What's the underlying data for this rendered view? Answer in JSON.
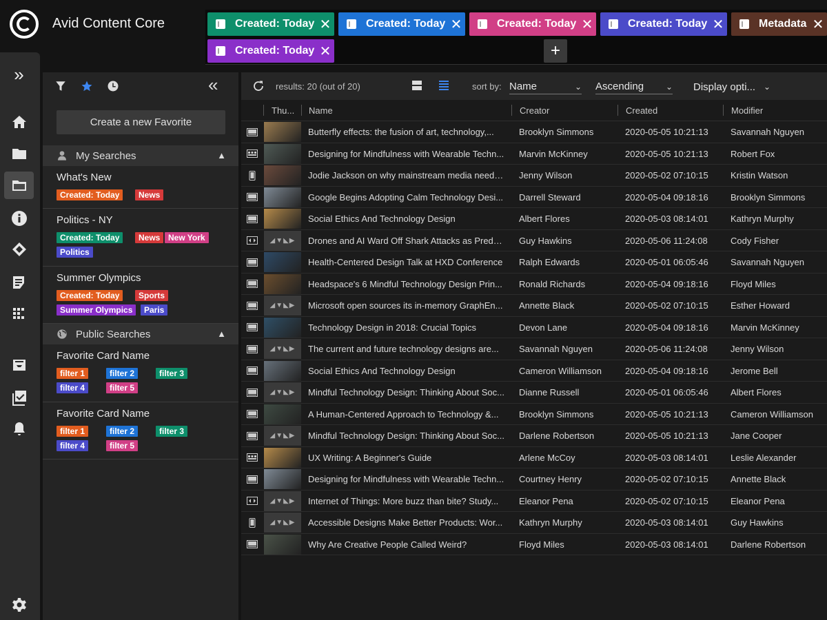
{
  "app": {
    "title": "Avid Content Core"
  },
  "tabs": [
    {
      "label": "Created: Today",
      "color": "#0e8f6b"
    },
    {
      "label": "Created: Today",
      "color": "#1e73d6"
    },
    {
      "label": "Created: Today",
      "color": "#d13f86"
    },
    {
      "label": "Created: Today",
      "color": "#4b4bc9"
    },
    {
      "label": "Metadata",
      "color": "#5a3326"
    },
    {
      "label": "Created: Today",
      "color": "#8a2fc9"
    }
  ],
  "tab_close_glyph": "✕",
  "tab_add_glyph": "+",
  "rail": {
    "expand_glyph": "»",
    "icons": [
      "home-icon",
      "folder-icon",
      "folder-open-icon",
      "info-icon",
      "link-icon",
      "checklist-icon",
      "grid-icon",
      "inbox-icon",
      "tasks-icon",
      "bell-icon",
      "settings-icon"
    ]
  },
  "favorites": {
    "create_label": "Create a new Favorite",
    "collapse_glyph": "«",
    "my_searches_label": "My Searches",
    "public_searches_label": "Public Searches",
    "my_searches": [
      {
        "title": "What's New",
        "tags": [
          {
            "label": "Created: Today",
            "color": "#e25d1f"
          },
          {
            "label": "News",
            "color": "#d63a3a"
          }
        ]
      },
      {
        "title": "Politics - NY",
        "tags": [
          {
            "label": "Created: Today",
            "color": "#0e8f6b"
          },
          {
            "label": "News",
            "color": "#d63a3a"
          },
          {
            "label": "New York",
            "color": "#d13f86"
          },
          {
            "label": "Politics",
            "color": "#4b4bc9"
          }
        ]
      },
      {
        "title": "Summer Olympics",
        "tags": [
          {
            "label": "Created: Today",
            "color": "#e25d1f"
          },
          {
            "label": "Sports",
            "color": "#d63a3a"
          },
          {
            "label": "Summer Olympics",
            "color": "#8a2fc9"
          },
          {
            "label": "Paris",
            "color": "#4b4bc9"
          }
        ]
      }
    ],
    "public_searches": [
      {
        "title": "Favorite Card Name",
        "tags": [
          {
            "label": "filter 1",
            "color": "#e25d1f"
          },
          {
            "label": "filter 2",
            "color": "#1e73d6"
          },
          {
            "label": "filter 3",
            "color": "#0e8f6b"
          },
          {
            "label": "filter 4",
            "color": "#4b4bc9"
          },
          {
            "label": "filter 5",
            "color": "#d13f86"
          }
        ]
      },
      {
        "title": "Favorite Card Name",
        "tags": [
          {
            "label": "filter 1",
            "color": "#e25d1f"
          },
          {
            "label": "filter 2",
            "color": "#1e73d6"
          },
          {
            "label": "filter 3",
            "color": "#0e8f6b"
          },
          {
            "label": "filter 4",
            "color": "#4b4bc9"
          },
          {
            "label": "filter 5",
            "color": "#d13f86"
          }
        ]
      }
    ]
  },
  "results": {
    "count_label": "results: 20 (out of 20)",
    "sort_by_label": "sort by:",
    "sort_field": "Name",
    "sort_order": "Ascending",
    "display_options": "Display opti...",
    "columns": [
      "Thu...",
      "Name",
      "Creator",
      "Created",
      "Modifier"
    ],
    "placeholder_thumb": "◢▼◣▶",
    "rows": [
      {
        "type": "video",
        "thumb": "#9a7b4f",
        "name": "Butterfly effects: the fusion of art, technology,...",
        "creator": "Brooklyn Simmons",
        "created": "2020-05-05 10:21:13",
        "modifier": "Savannah Nguyen"
      },
      {
        "type": "sequence",
        "thumb": "#4f5a55",
        "name": "Designing for Mindfulness with Wearable Techn...",
        "creator": "Marvin McKinney",
        "created": "2020-05-05 10:21:13",
        "modifier": "Robert Fox"
      },
      {
        "type": "mobile",
        "thumb": "#6a4a3c",
        "name": "Jodie Jackson on why mainstream media needs...",
        "creator": "Jenny Wilson",
        "created": "2020-05-02 07:10:15",
        "modifier": "Kristin Watson"
      },
      {
        "type": "video",
        "thumb": "#7f8a95",
        "name": "Google Begins Adopting Calm Technology Desi...",
        "creator": "Darrell Steward",
        "created": "2020-05-04 09:18:16",
        "modifier": "Brooklyn Simmons"
      },
      {
        "type": "video",
        "thumb": "#b58a4a",
        "name": "Social Ethics And Technology Design",
        "creator": "Albert Flores",
        "created": "2020-05-03 08:14:01",
        "modifier": "Kathryn Murphy"
      },
      {
        "type": "audio",
        "thumb": "",
        "name": "Drones and AI Ward Off Shark Attacks as Preda...",
        "creator": "Guy Hawkins",
        "created": "2020-05-06 11:24:08",
        "modifier": "Cody Fisher"
      },
      {
        "type": "video",
        "thumb": "#2e4a66",
        "name": "Health-Centered Design Talk at HXD Conference",
        "creator": "Ralph Edwards",
        "created": "2020-05-01 06:05:46",
        "modifier": "Savannah Nguyen"
      },
      {
        "type": "video",
        "thumb": "#6b4e2e",
        "name": "Headspace's 6 Mindful Technology Design Prin...",
        "creator": "Ronald Richards",
        "created": "2020-05-04 09:18:16",
        "modifier": "Floyd Miles"
      },
      {
        "type": "video",
        "thumb": "",
        "name": "Microsoft open sources its in-memory GraphEn...",
        "creator": "Annette Black",
        "created": "2020-05-02 07:10:15",
        "modifier": "Esther Howard"
      },
      {
        "type": "video",
        "thumb": "#2f4f66",
        "name": "Technology Design in 2018: Crucial Topics",
        "creator": "Devon Lane",
        "created": "2020-05-04 09:18:16",
        "modifier": "Marvin McKinney"
      },
      {
        "type": "video",
        "thumb": "",
        "name": "The current and future technology designs are...",
        "creator": "Savannah Nguyen",
        "created": "2020-05-06 11:24:08",
        "modifier": "Jenny Wilson"
      },
      {
        "type": "video",
        "thumb": "#66707a",
        "name": "Social Ethics And Technology Design",
        "creator": "Cameron Williamson",
        "created": "2020-05-04 09:18:16",
        "modifier": "Jerome Bell"
      },
      {
        "type": "video",
        "thumb": "",
        "name": "Mindful Technology Design: Thinking About Soc...",
        "creator": "Dianne Russell",
        "created": "2020-05-01 06:05:46",
        "modifier": "Albert Flores"
      },
      {
        "type": "video",
        "thumb": "#3e4a42",
        "name": "A Human-Centered Approach to Technology &...",
        "creator": "Brooklyn Simmons",
        "created": "2020-05-05 10:21:13",
        "modifier": "Cameron Williamson"
      },
      {
        "type": "video",
        "thumb": "",
        "name": "Mindful Technology Design: Thinking About Soc...",
        "creator": "Darlene Robertson",
        "created": "2020-05-05 10:21:13",
        "modifier": "Jane Cooper"
      },
      {
        "type": "sequence",
        "thumb": "#b58a4a",
        "name": "UX Writing: A Beginner's Guide",
        "creator": "Arlene McCoy",
        "created": "2020-05-03 08:14:01",
        "modifier": "Leslie Alexander"
      },
      {
        "type": "video",
        "thumb": "#7f8a95",
        "name": "Designing for Mindfulness with Wearable Techn...",
        "creator": "Courtney Henry",
        "created": "2020-05-02 07:10:15",
        "modifier": "Annette Black"
      },
      {
        "type": "audio",
        "thumb": "",
        "name": "Internet of Things: More buzz than bite? Study...",
        "creator": "Eleanor Pena",
        "created": "2020-05-02 07:10:15",
        "modifier": "Eleanor Pena"
      },
      {
        "type": "mobile",
        "thumb": "",
        "name": "Accessible Designs Make Better Products: Wor...",
        "creator": "Kathryn Murphy",
        "created": "2020-05-03 08:14:01",
        "modifier": "Guy Hawkins"
      },
      {
        "type": "video",
        "thumb": "#4a5248",
        "name": "Why Are Creative People Called Weird?",
        "creator": "Floyd Miles",
        "created": "2020-05-03 08:14:01",
        "modifier": "Darlene Robertson"
      }
    ]
  }
}
